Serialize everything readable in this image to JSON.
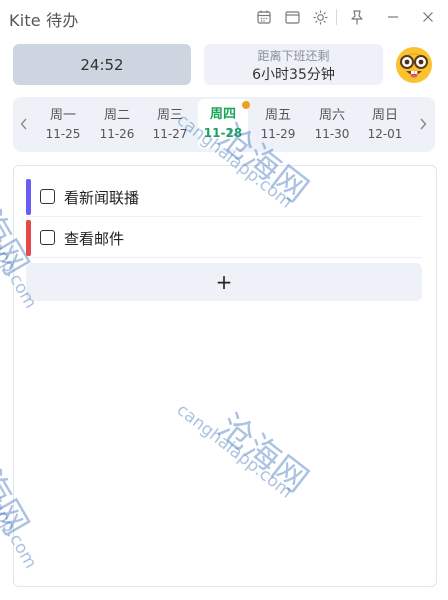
{
  "window": {
    "title": "Kite 待办",
    "icons": [
      "calendar-icon",
      "window-icon",
      "sun-icon",
      "pin-icon",
      "minimize-icon",
      "close-icon"
    ]
  },
  "status": {
    "timer": "24:52",
    "offwork_label": "距离下班还剩",
    "offwork_value": "6小时35分钟",
    "avatar": "nerd-face-emoji"
  },
  "week": {
    "prev_icon": "chevron-left-icon",
    "next_icon": "chevron-right-icon",
    "days": [
      {
        "name": "周一",
        "date": "11-25"
      },
      {
        "name": "周二",
        "date": "11-26"
      },
      {
        "name": "周三",
        "date": "11-27"
      },
      {
        "name": "周四",
        "date": "11-28"
      },
      {
        "name": "周五",
        "date": "11-29"
      },
      {
        "name": "周六",
        "date": "11-30"
      },
      {
        "name": "周日",
        "date": "12-01"
      }
    ],
    "active_day": "周四",
    "accent_color": "#19a35b",
    "dot_color": "#f0a020"
  },
  "tasks": [
    {
      "label": "看新闻联播",
      "color": "#6b5cf6",
      "done": false
    },
    {
      "label": "查看邮件",
      "color": "#e5484d",
      "done": false
    }
  ],
  "add_button": "+",
  "watermark": {
    "cn": "沧海网",
    "url": "canghaiapp.com"
  }
}
